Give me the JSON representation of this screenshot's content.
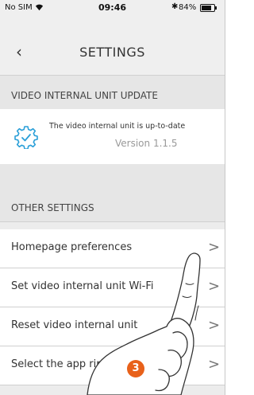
{
  "status_bar": {
    "carrier": "No SIM",
    "time": "09:46",
    "bluetooth": "✱",
    "battery_text": "84%",
    "battery_level": 0.84
  },
  "nav": {
    "back_icon": "chevron-left-icon",
    "back_glyph": "‹",
    "title": "SETTINGS"
  },
  "update_section": {
    "header": "VIDEO INTERNAL UNIT UPDATE",
    "status": "The video internal unit is up-to-date",
    "version": "Version 1.1.5",
    "icon": "gear-check-icon",
    "icon_color": "#2a9fd8"
  },
  "other_section": {
    "header": "OTHER SETTINGS",
    "items": [
      {
        "label": "Homepage preferences",
        "chevron": ">"
      },
      {
        "label": "Set video internal unit Wi-Fi",
        "chevron": ">"
      },
      {
        "label": "Reset video internal unit",
        "chevron": ">"
      },
      {
        "label": "Select the app ringtone",
        "chevron": ">"
      }
    ]
  },
  "overlay": {
    "step_number": "3",
    "step_color": "#e8611a",
    "hand_icon": "pointing-hand-icon"
  }
}
